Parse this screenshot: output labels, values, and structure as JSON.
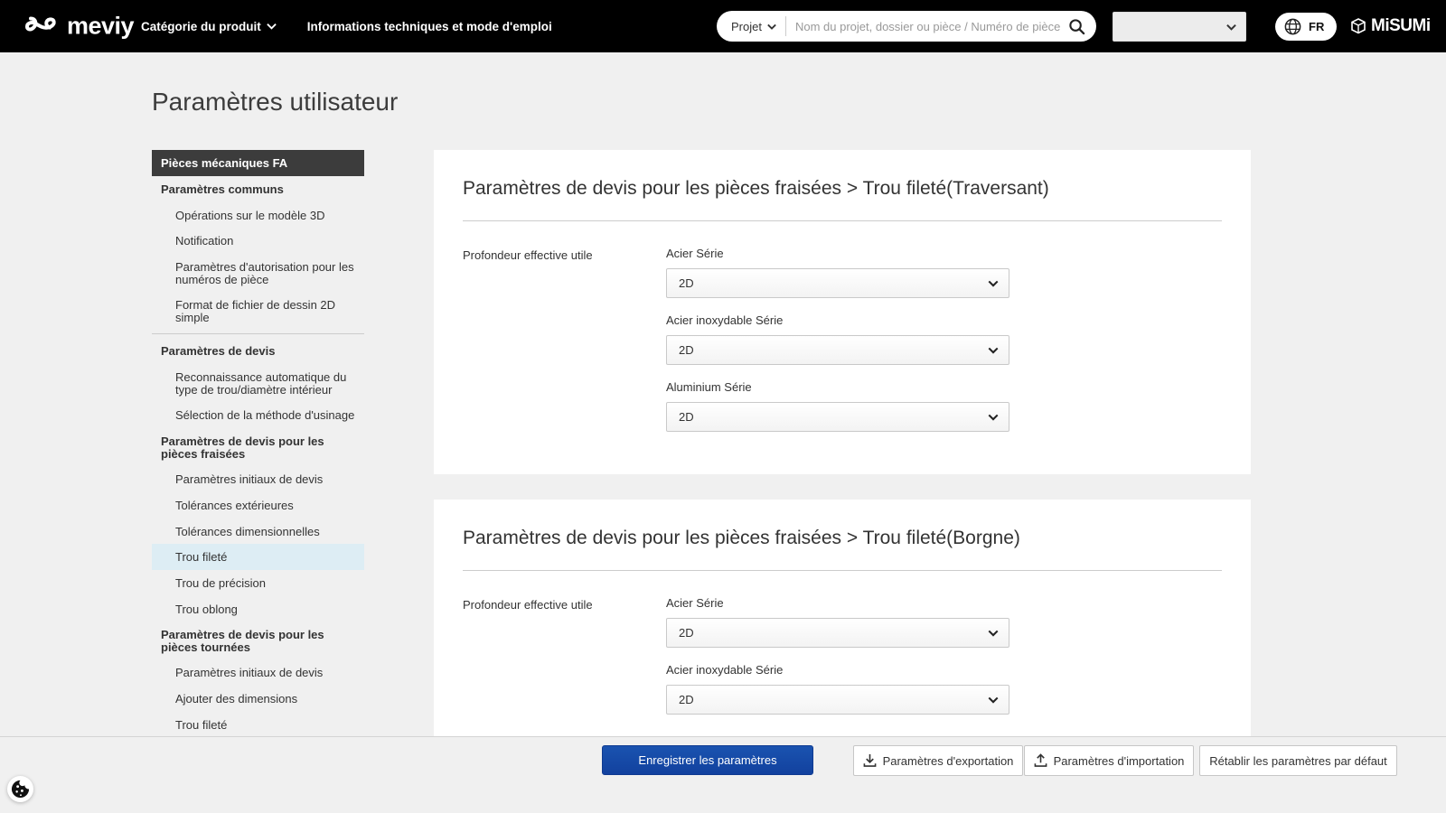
{
  "header": {
    "brand": "meviy",
    "nav_category": "Catégorie du produit",
    "nav_info": "Informations techniques et mode d'emploi",
    "search": {
      "scope": "Projet",
      "placeholder": "Nom du projet, dossier ou pièce / Numéro de pièce"
    },
    "language": "FR",
    "partner_brand": "MiSUMi"
  },
  "page": {
    "title": "Paramètres utilisateur"
  },
  "sidebar": {
    "root": "Pièces mécaniques FA",
    "items": [
      {
        "label": "Paramètres communs",
        "type": "section"
      },
      {
        "label": "Opérations sur le modèle 3D",
        "type": "item"
      },
      {
        "label": "Notification",
        "type": "item"
      },
      {
        "label": "Paramètres d'autorisation pour les numéros de pièce",
        "type": "item"
      },
      {
        "label": "Format de fichier de dessin 2D simple",
        "type": "item"
      },
      {
        "label": "Paramètres de devis",
        "type": "section",
        "divider_before": true
      },
      {
        "label": "Reconnaissance automatique du type de trou/diamètre intérieur",
        "type": "item"
      },
      {
        "label": "Sélection de la méthode d'usinage",
        "type": "item"
      },
      {
        "label": "Paramètres de devis pour les pièces fraisées",
        "type": "section"
      },
      {
        "label": "Paramètres initiaux de devis",
        "type": "item"
      },
      {
        "label": "Tolérances extérieures",
        "type": "item"
      },
      {
        "label": "Tolérances dimensionnelles",
        "type": "item"
      },
      {
        "label": "Trou fileté",
        "type": "item",
        "selected": true
      },
      {
        "label": "Trou de précision",
        "type": "item"
      },
      {
        "label": "Trou oblong",
        "type": "item"
      },
      {
        "label": "Paramètres de devis pour les pièces tournées",
        "type": "section"
      },
      {
        "label": "Paramètres initiaux de devis",
        "type": "item"
      },
      {
        "label": "Ajouter des dimensions",
        "type": "item"
      },
      {
        "label": "Trou fileté",
        "type": "item"
      }
    ]
  },
  "cards": [
    {
      "title": "Paramètres de devis pour les pièces fraisées > Trou fileté(Traversant)",
      "row_label": "Profondeur effective utile",
      "fields": [
        {
          "label": "Acier Série",
          "value": "2D"
        },
        {
          "label": "Acier inoxydable Série",
          "value": "2D"
        },
        {
          "label": "Aluminium Série",
          "value": "2D"
        }
      ]
    },
    {
      "title": "Paramètres de devis pour les pièces fraisées > Trou fileté(Borgne)",
      "row_label": "Profondeur effective utile",
      "fields": [
        {
          "label": "Acier Série",
          "value": "2D"
        },
        {
          "label": "Acier inoxydable Série",
          "value": "2D"
        }
      ]
    }
  ],
  "footer": {
    "save": "Enregistrer les paramètres",
    "export": "Paramètres d'exportation",
    "import": "Paramètres d'importation",
    "reset": "Rétablir les paramètres par défaut"
  },
  "colors": {
    "header_bg": "#000000",
    "page_bg": "#f0f0f0",
    "accent_blue": "#12419e",
    "selected_item_bg": "#ddedf4",
    "sidebar_root_bg": "#3c3c3c"
  }
}
